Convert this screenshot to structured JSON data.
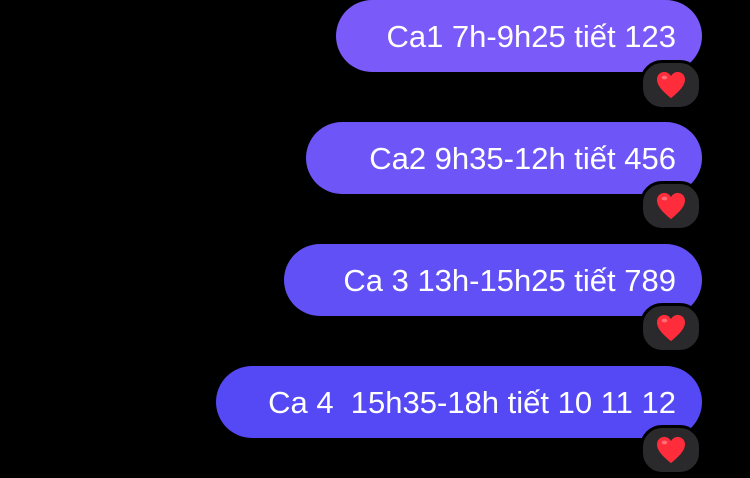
{
  "messages": [
    {
      "text": "Ca1 7h-9h25 tiết 123",
      "bubble_color": "#7a5af8",
      "reaction": "heart-emoji"
    },
    {
      "text": "Ca2 9h35-12h tiết 456",
      "bubble_color": "#6e55f7",
      "reaction": "heart-emoji"
    },
    {
      "text": "Ca 3 13h-15h25 tiết 789",
      "bubble_color": "#6150f6",
      "reaction": "heart-emoji"
    },
    {
      "text": "Ca 4  15h35-18h tiết 10 11 12",
      "bubble_color": "#5549f5",
      "reaction": "heart-emoji"
    }
  ],
  "colors": {
    "background": "#000000",
    "reaction_pill": "#2a2a2c",
    "heart": "#ff2d3c"
  }
}
